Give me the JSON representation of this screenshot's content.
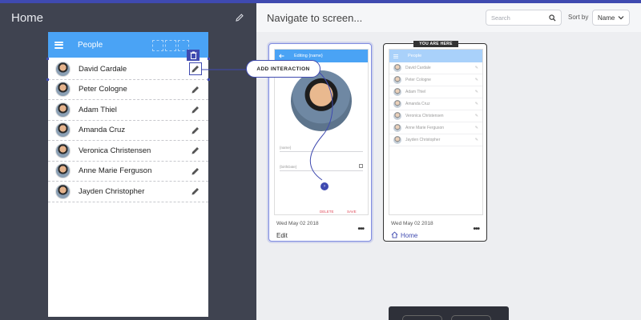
{
  "left_panel": {
    "title": "Home"
  },
  "phone": {
    "appbar_title": "People",
    "people": [
      {
        "name": "David Cardale"
      },
      {
        "name": "Peter Cologne"
      },
      {
        "name": "Adam Thiel"
      },
      {
        "name": "Amanda Cruz"
      },
      {
        "name": "Veronica Christensen"
      },
      {
        "name": "Anne Marie Ferguson"
      },
      {
        "name": "Jayden Christopher"
      }
    ]
  },
  "right_panel": {
    "title": "Navigate to screen...",
    "search_placeholder": "Search",
    "sort_label": "Sort by",
    "sort_value": "Name"
  },
  "add_interaction_label": "ADD INTERACTION",
  "cards": [
    {
      "thumb_title": "Editing {name}",
      "field_name": "{name}",
      "field_birth": "{birthDate}",
      "delete_label": "DELETE",
      "save_label": "SAVE",
      "date": "Wed May 02 2018",
      "name": "Edit"
    },
    {
      "badge": "YOU ARE HERE",
      "thumb_title": "People",
      "date": "Wed May 02 2018",
      "name": "Home"
    }
  ],
  "colors": {
    "accent": "#3f4ab0",
    "appbar": "#4aa3f5",
    "left_bg": "#3f4350",
    "danger": "#e04a5a"
  },
  "icons": {
    "edit_title": "pencil-icon",
    "menu": "hamburger-icon",
    "trash": "trash-icon",
    "row_edit": "pencil-icon",
    "search": "search-icon",
    "sort": "chevron-down-icon",
    "home": "home-icon",
    "more": "more-horizontal-icon"
  }
}
